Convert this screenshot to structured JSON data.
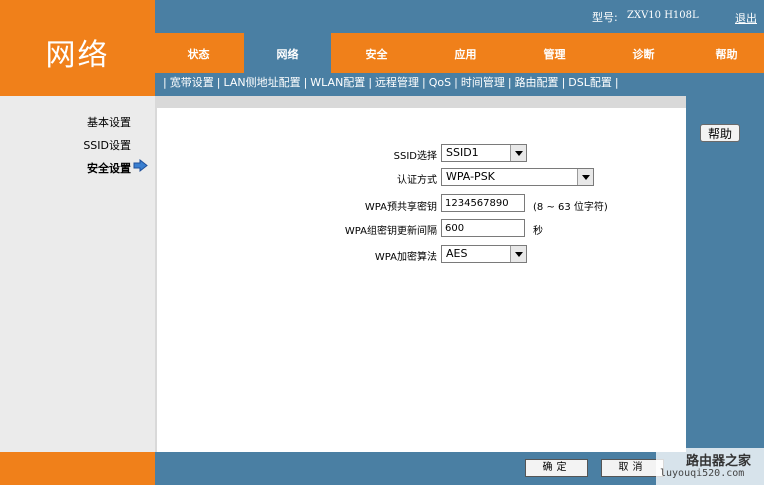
{
  "brand": {
    "title": "网络"
  },
  "header": {
    "model_label": "型号:",
    "model_value": "ZXV10 H108L",
    "logout": "退出"
  },
  "tabs": [
    {
      "label": "状态"
    },
    {
      "label": "网络"
    },
    {
      "label": "安全"
    },
    {
      "label": "应用"
    },
    {
      "label": "管理"
    },
    {
      "label": "诊断"
    },
    {
      "label": "帮助"
    }
  ],
  "submenu": [
    {
      "label": "宽带设置"
    },
    {
      "label": "LAN侧地址配置"
    },
    {
      "label": "WLAN配置"
    },
    {
      "label": "远程管理"
    },
    {
      "label": "QoS"
    },
    {
      "label": "时间管理"
    },
    {
      "label": "路由配置"
    },
    {
      "label": "DSL配置"
    }
  ],
  "sidebar": {
    "items": [
      {
        "label": "基本设置"
      },
      {
        "label": "SSID设置"
      },
      {
        "label": "安全设置"
      }
    ]
  },
  "form": {
    "ssid_label": "SSID选择",
    "ssid_value": "SSID1",
    "auth_label": "认证方式",
    "auth_value": "WPA-PSK",
    "psk_label": "WPA预共享密钥",
    "psk_value": "1234567890",
    "psk_hint": "(8 ~ 63 位字符)",
    "rekey_label": "WPA组密钥更新间隔",
    "rekey_value": "600",
    "rekey_unit": "秒",
    "cipher_label": "WPA加密算法",
    "cipher_value": "AES"
  },
  "help": {
    "label": "帮助"
  },
  "footer": {
    "confirm": "确定",
    "cancel": "取消"
  },
  "watermark": {
    "line1": "路由器之家",
    "line2": "luyouqi520.com"
  },
  "colors": {
    "orange": "#f0801a",
    "blue": "#4a7fa3",
    "sidebar": "#ebebeb"
  }
}
